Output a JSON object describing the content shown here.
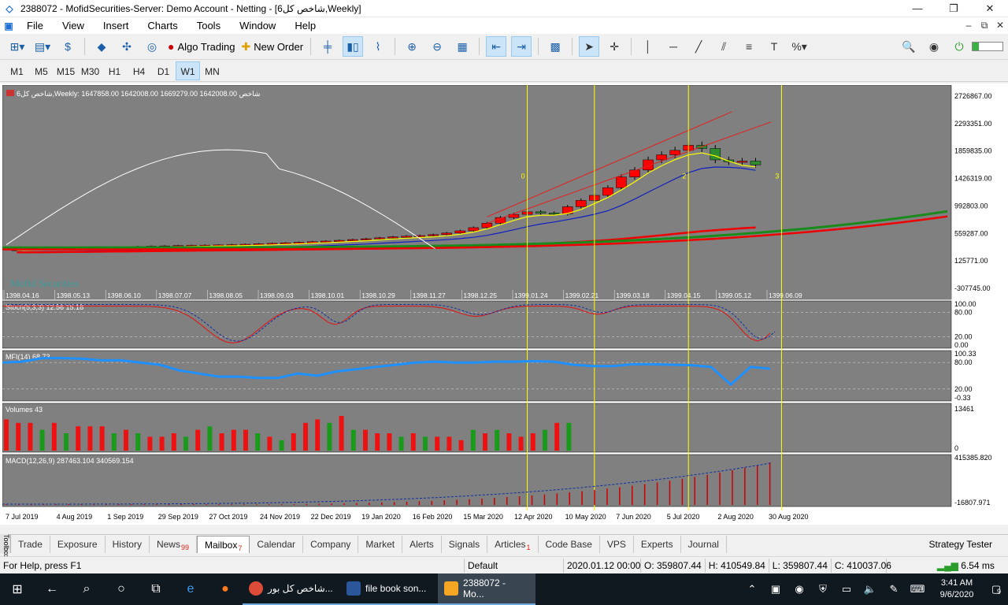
{
  "window": {
    "title": "2388072 - MofidSecurities-Server: Demo Account - Netting - [شاخص کل6,Weekly]"
  },
  "menu": [
    "File",
    "View",
    "Insert",
    "Charts",
    "Tools",
    "Window",
    "Help"
  ],
  "toolbar": {
    "algo_trading": "Algo Trading",
    "new_order": "New Order"
  },
  "timeframes": {
    "items": [
      "M1",
      "M5",
      "M15",
      "M30",
      "H1",
      "H4",
      "D1",
      "W1",
      "MN"
    ],
    "active": "W1"
  },
  "chart": {
    "header": "شاخص کل6,Weekly:  1647858.00 1642008.00 1669279.00 1642008.00  شاخص",
    "watermark": "Mofid Securities",
    "price_labels": [
      "2726867.00",
      "2293351.00",
      "1859835.00",
      "1426319.00",
      "992803.00",
      "559287.00",
      "125771.00",
      "-307745.00"
    ],
    "persian_dates": [
      "1398.04.16",
      "1398.05.13",
      "1398.06.10",
      "1398.07.07",
      "1398.08.05",
      "1398.09.03",
      "1398.10.01",
      "1398.10.29",
      "1398.11.27",
      "1398.12.25",
      "1399.01.24",
      "1399.02.21",
      "1399.03.18",
      "1399.04.15",
      "1399.05.12",
      "1399.06.09"
    ],
    "bottom_dates": [
      "7 Jul 2019",
      "4 Aug 2019",
      "1 Sep 2019",
      "29 Sep 2019",
      "27 Oct 2019",
      "24 Nov 2019",
      "22 Dec 2019",
      "19 Jan 2020",
      "16 Feb 2020",
      "15 Mar 2020",
      "12 Apr 2020",
      "10 May 2020",
      "7 Jun 2020",
      "5 Jul 2020",
      "2 Aug 2020",
      "30 Aug 2020"
    ],
    "wave_labels": [
      "0",
      "2",
      "3"
    ],
    "stoch": {
      "label": "Stoch(5,3,3) 12.56 15.18",
      "levels": [
        "100.00",
        "80.00",
        "20.00",
        "0.00"
      ]
    },
    "mfi": {
      "label": "MFI(14) 68.73",
      "levels": [
        "100.33",
        "80.00",
        "20.00",
        "-0.33"
      ]
    },
    "volumes": {
      "label": "Volumes 43",
      "levels": [
        "13461",
        "0"
      ]
    },
    "macd": {
      "label": "MACD(12,26,9) 287463.104 340569.154",
      "levels": [
        "415385.820",
        "-16807.971"
      ]
    },
    "colors": {
      "background": "#808080",
      "bull_candle": "#2e8b2e",
      "bear_candle": "#ff0000",
      "vline": "#ffff00",
      "mfi_line": "#1e90ff",
      "macd_bar": "#cc0000"
    }
  },
  "chart_data": {
    "type": "candlestick",
    "title": "شاخص کل6,Weekly",
    "ohlc_last": {
      "open": 1647858.0,
      "high": 1642008.0,
      "low": 1669279.0,
      "close": 1642008.0
    },
    "ylim": [
      -307745.0,
      2726867.0
    ],
    "x_categories": [
      "7 Jul 2019",
      "4 Aug 2019",
      "1 Sep 2019",
      "29 Sep 2019",
      "27 Oct 2019",
      "24 Nov 2019",
      "22 Dec 2019",
      "19 Jan 2020",
      "16 Feb 2020",
      "15 Mar 2020",
      "12 Apr 2020",
      "10 May 2020",
      "7 Jun 2020",
      "5 Jul 2020",
      "2 Aug 2020",
      "30 Aug 2020"
    ],
    "close_series": [
      305000,
      309000,
      312000,
      318000,
      322000,
      328000,
      333000,
      338000,
      345000,
      352000,
      358000,
      362000,
      368000,
      371000,
      374000,
      378000,
      382000,
      388000,
      395000,
      402000,
      410000,
      418000,
      428000,
      438000,
      450000,
      462000,
      475000,
      490000,
      505000,
      515000,
      525000,
      540000,
      565000,
      600000,
      650000,
      720000,
      810000,
      860000,
      900000,
      880000,
      870000,
      980000,
      1080000,
      1160000,
      1280000,
      1450000,
      1560000,
      1720000,
      1800000,
      1870000,
      1950000,
      1900000,
      1720000,
      1690000,
      1700000,
      1642008
    ]
  },
  "tabs": {
    "items": [
      "Trade",
      "Exposure",
      "History",
      "News",
      "Mailbox",
      "Calendar",
      "Company",
      "Market",
      "Alerts",
      "Signals",
      "Articles",
      "Code Base",
      "VPS",
      "Experts",
      "Journal"
    ],
    "badges": {
      "News": "99",
      "Mailbox": "7",
      "Articles": "1"
    },
    "active": "Mailbox",
    "strategy_tester": "Strategy Tester",
    "toolbox": "Toolbox"
  },
  "status": {
    "help": "For Help, press F1",
    "profile": "Default",
    "datetime": "2020.01.12 00:00",
    "open": "O: 359807.44",
    "high": "H: 410549.84",
    "low": "L: 359807.44",
    "close": "C: 410037.06",
    "ping": "6.54 ms"
  },
  "taskbar": {
    "apps": [
      "شاخص کل بور...",
      "file book son...",
      "2388072 - Mo..."
    ],
    "time": "3:41 AM",
    "date": "9/6/2020",
    "notifications": "9"
  }
}
